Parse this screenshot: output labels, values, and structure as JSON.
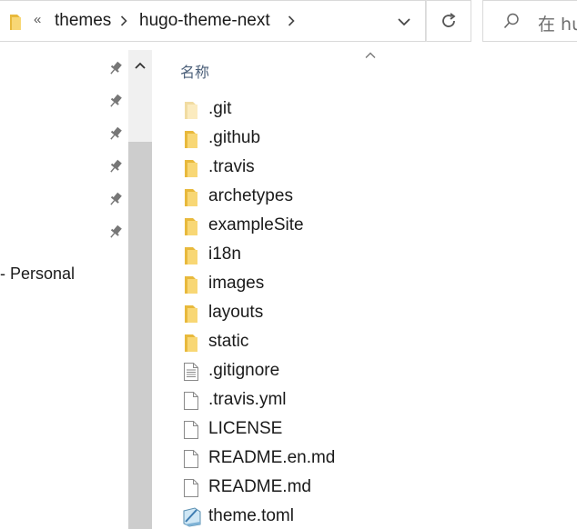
{
  "address_bar": {
    "overflow_chevrons": "«",
    "breadcrumbs": [
      "themes",
      "hugo-theme-next"
    ]
  },
  "search": {
    "placeholder": "在 hu"
  },
  "nav_pane": {
    "quick_access_pins": 6,
    "items": [
      {
        "label": "- Personal"
      }
    ]
  },
  "file_list": {
    "column_header": "名称",
    "sort": "ascending",
    "items": [
      {
        "name": ".git",
        "icon": "folder-icon-faded"
      },
      {
        "name": ".github",
        "icon": "folder-icon"
      },
      {
        "name": ".travis",
        "icon": "folder-icon"
      },
      {
        "name": "archetypes",
        "icon": "folder-icon"
      },
      {
        "name": "exampleSite",
        "icon": "folder-icon"
      },
      {
        "name": "i18n",
        "icon": "folder-icon"
      },
      {
        "name": "images",
        "icon": "folder-icon"
      },
      {
        "name": "layouts",
        "icon": "folder-icon"
      },
      {
        "name": "static",
        "icon": "folder-icon"
      },
      {
        "name": ".gitignore",
        "icon": "text-file-icon"
      },
      {
        "name": ".travis.yml",
        "icon": "blank-file-icon"
      },
      {
        "name": "LICENSE",
        "icon": "blank-file-icon"
      },
      {
        "name": "README.en.md",
        "icon": "blank-file-icon"
      },
      {
        "name": "README.md",
        "icon": "blank-file-icon"
      },
      {
        "name": "theme.toml",
        "icon": "toml-file-icon"
      }
    ]
  },
  "colors": {
    "folder_yellow": "#f8d775",
    "folder_shade": "#e8b93c",
    "header_text": "#4c607a",
    "scroll_thumb": "#cdcdcd",
    "scroll_track": "#f0f0f0"
  }
}
